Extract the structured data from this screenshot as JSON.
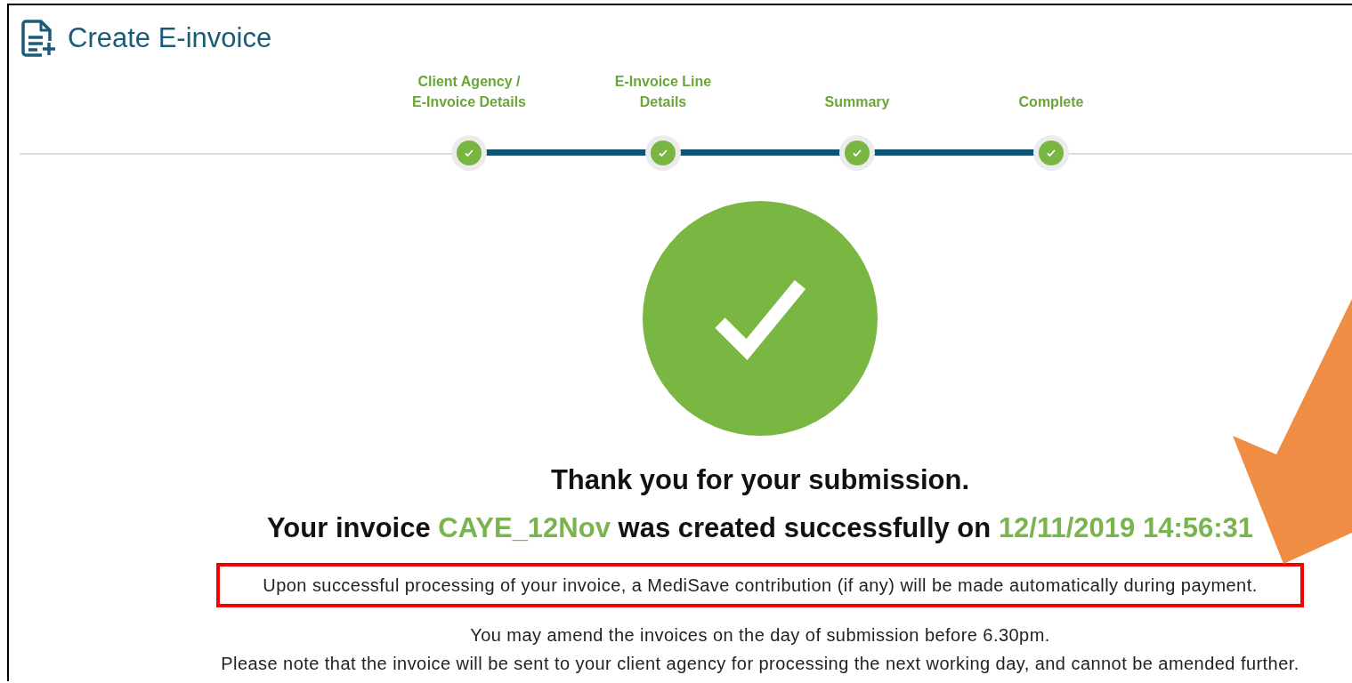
{
  "page": {
    "title": "Create E-invoice"
  },
  "steps": [
    {
      "label": "Client Agency /\nE-Invoice Details",
      "completed": true
    },
    {
      "label": "E-Invoice Line\nDetails",
      "completed": true
    },
    {
      "label": "Summary",
      "completed": true
    },
    {
      "label": "Complete",
      "completed": true
    }
  ],
  "result": {
    "success": true,
    "heading": "Thank you for your submission.",
    "invoice_line": {
      "prefix": "Your invoice",
      "invoice_id": "CAYE_12Nov",
      "middle": "was created successfully on",
      "timestamp": "12/11/2019 14:56:31"
    }
  },
  "notice": {
    "text": "Upon successful processing of your invoice, a MediSave contribution (if any) will be made automatically during payment.",
    "highlighted": true
  },
  "notes": [
    "You may amend the invoices on the day of submission before 6.30pm.",
    "Please note that the invoice will be sent to your client agency for processing the next working day, and cannot be amended further."
  ],
  "annotation": {
    "arrow": true
  }
}
